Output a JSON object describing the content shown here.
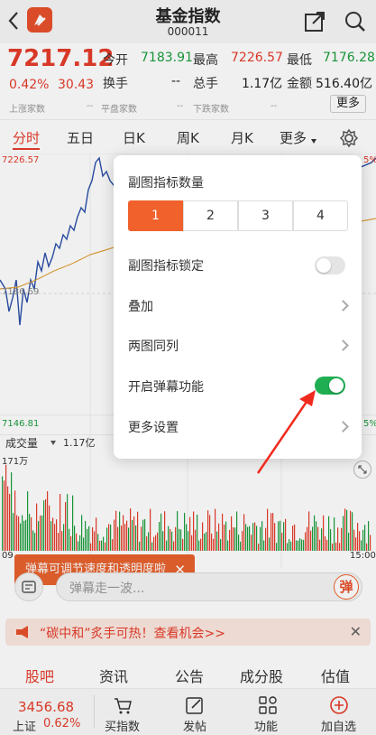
{
  "header": {
    "title": "基金指数",
    "code": "000011"
  },
  "quote": {
    "price": "7217.12",
    "change_pct": "0.42%",
    "change_abs": "30.43",
    "open_label": "今开",
    "open": "7183.91",
    "high_label": "最高",
    "high": "7226.57",
    "low_label": "最低",
    "low": "7176.28",
    "turnover_label": "换手",
    "turnover": "--",
    "hand_label": "总手",
    "hand": "1.17亿",
    "amount_label": "金额",
    "amount": "516.40亿",
    "up_label": "上涨家数",
    "up": "--",
    "flat_label": "平盘家数",
    "flat": "--",
    "down_label": "下跌家数",
    "down": "--",
    "more": "更多"
  },
  "period_tabs": [
    "分时",
    "五日",
    "日K",
    "周K",
    "月K",
    "更多"
  ],
  "chart": {
    "top_price": "7226.57",
    "mid_price": "7186.69",
    "bottom_price": "7146.81",
    "pct_top": "5%",
    "pct_bottom": "5%",
    "volume_label": "成交量",
    "volume_value": "1.17亿",
    "volume_max": "171万",
    "time_start": "09",
    "time_end": "15:00"
  },
  "popup": {
    "count_label": "副图指标数量",
    "count_options": [
      "1",
      "2",
      "3",
      "4"
    ],
    "lock_label": "副图指标锁定",
    "overlay_label": "叠加",
    "dual_label": "两图同列",
    "danmu_label": "开启弹幕功能",
    "more_label": "更多设置"
  },
  "tip": "弹幕可调节速度和透明度啦",
  "danmu": {
    "placeholder": "弹幕走一波...",
    "button": "弹"
  },
  "promo": "“碳中和”炙手可热！查看机会>>",
  "bottom_tabs": [
    "股吧",
    "资讯",
    "公告",
    "成分股",
    "估值"
  ],
  "footer": {
    "index_value": "3456.68",
    "index_name": "上证",
    "index_pct": "0.62%",
    "buy": "买指数",
    "post": "发帖",
    "func": "功能",
    "add": "加自选"
  },
  "colors": {
    "accent": "#f0612c",
    "up": "#e63c2a",
    "down": "#1a9e3c",
    "toggle_on": "#1fae52"
  }
}
